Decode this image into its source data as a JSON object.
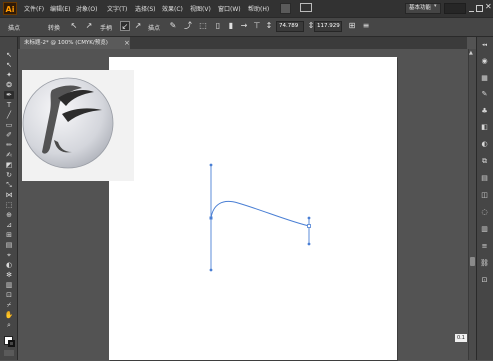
{
  "app": {
    "logo": "Ai"
  },
  "menu": [
    "文件(F)",
    "编辑(E)",
    "对象(O)",
    "文字(T)",
    "选择(S)",
    "效果(C)",
    "视图(V)",
    "窗口(W)",
    "帮助(H)"
  ],
  "workspace": {
    "label": "基本功能"
  },
  "control_bar": {
    "tool_label": "描点",
    "convert_label": "转换",
    "handles_label": "手柄",
    "anchor_label": "描点",
    "x_value": "74.789",
    "y_value": "117.929"
  },
  "document_tab": {
    "title": "未标题-2* @ 100% (CMYK/预览)"
  },
  "status": {
    "coord_readout": "0.1"
  },
  "icons": {
    "tools": [
      "selection-icon",
      "direct-selection-icon",
      "magic-wand-icon",
      "lasso-icon",
      "pen-icon",
      "type-icon",
      "line-icon",
      "rectangle-icon",
      "paintbrush-icon",
      "pencil-icon",
      "blob-brush-icon",
      "eraser-icon",
      "rotate-icon",
      "scale-icon",
      "width-icon",
      "free-transform-icon",
      "shape-builder-icon",
      "perspective-icon",
      "mesh-icon",
      "gradient-icon",
      "eyedropper-icon",
      "blend-icon",
      "symbol-sprayer-icon",
      "column-graph-icon",
      "artboard-icon",
      "slice-icon",
      "hand-icon",
      "zoom-icon"
    ],
    "panels": [
      "color-icon",
      "swatches-icon",
      "brushes-icon",
      "symbols-icon",
      "graphic-styles-icon",
      "appearance-icon",
      "layers-icon",
      "align-icon",
      "pathfinder-icon",
      "transparency-icon",
      "gradient-panel-icon",
      "stroke-icon",
      "links-icon",
      "artboards-icon"
    ]
  },
  "colors": {
    "path_stroke": "#4a7fd4",
    "accent": "#ff9a00"
  }
}
